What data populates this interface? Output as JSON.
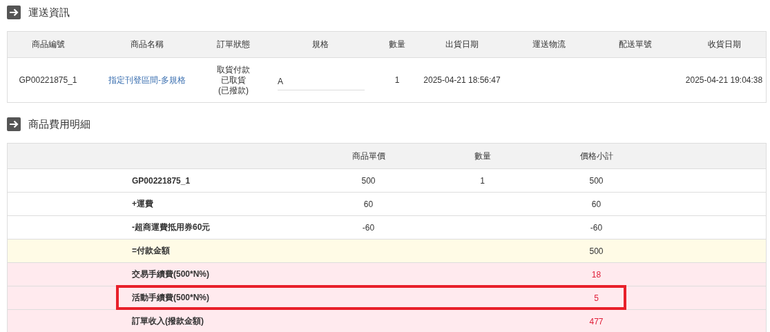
{
  "shipping": {
    "title": "運送資訊",
    "columns": [
      "商品編號",
      "商品名稱",
      "訂單狀態",
      "規格",
      "數量",
      "出貨日期",
      "運送物流",
      "配送單號",
      "收貨日期"
    ],
    "rows": [
      {
        "product_no": "GP00221875_1",
        "product_name": "指定刊登區間-多規格",
        "status": [
          "取貨付款",
          "已取貨",
          "(已撥款)"
        ],
        "spec": "A",
        "quantity": "1",
        "ship_date": "2025-04-21 18:56:47",
        "receive_date": "2025-04-21 19:04:38"
      }
    ]
  },
  "fees": {
    "title": "商品費用明細",
    "columns": [
      "商品單價",
      "數量",
      "價格小計"
    ],
    "rows": [
      {
        "kind": "normal",
        "label": "GP00221875_1",
        "unit_price": "500",
        "quantity": "1",
        "subtotal": "500",
        "highlighted": false
      },
      {
        "kind": "normal",
        "label": "+運費",
        "unit_price": "60",
        "subtotal": "60",
        "highlighted": false
      },
      {
        "kind": "normal",
        "label": "-超商運費抵用券60元",
        "unit_price": "-60",
        "subtotal": "-60",
        "highlighted": false
      },
      {
        "kind": "total",
        "label": "=付款金額",
        "subtotal": "500",
        "highlighted": false
      },
      {
        "kind": "fee",
        "label": "交易手續費(500*N%)",
        "subtotal": "18",
        "highlighted": false
      },
      {
        "kind": "fee",
        "label": "活動手續費(500*N%)",
        "subtotal": "5",
        "highlighted": true
      },
      {
        "kind": "fee",
        "label": "訂單收入(撥款金額)",
        "subtotal": "477",
        "highlighted": false
      }
    ]
  }
}
